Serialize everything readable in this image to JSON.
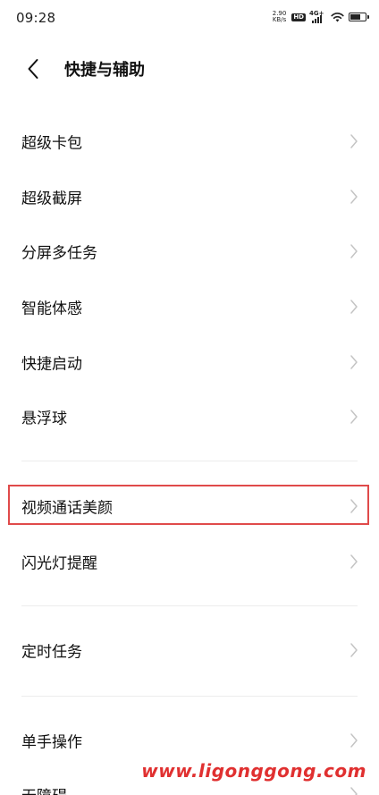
{
  "status_bar": {
    "time": "09:28",
    "net_speed_value": "2.90",
    "net_speed_unit": "KB/s",
    "hd_badge": "HD",
    "network_type": "4G+",
    "icons": [
      "hd-icon",
      "signal-icon",
      "wifi-icon",
      "battery-icon"
    ]
  },
  "header": {
    "back_icon": "chevron-left-icon",
    "title": "快捷与辅助"
  },
  "rows": [
    {
      "label": "超级卡包"
    },
    {
      "label": "超级截屏"
    },
    {
      "label": "分屏多任务"
    },
    {
      "label": "智能体感"
    },
    {
      "label": "快捷启动"
    },
    {
      "label": "悬浮球"
    },
    {
      "label": "视频通话美颜",
      "highlighted": true
    },
    {
      "label": "闪光灯提醒"
    },
    {
      "label": "定时任务"
    },
    {
      "label": "单手操作"
    },
    {
      "label": "无障碍"
    }
  ],
  "highlight_color": "#e04a4a",
  "watermark": {
    "text": "www.ligonggong.com",
    "color": "#e03030"
  }
}
